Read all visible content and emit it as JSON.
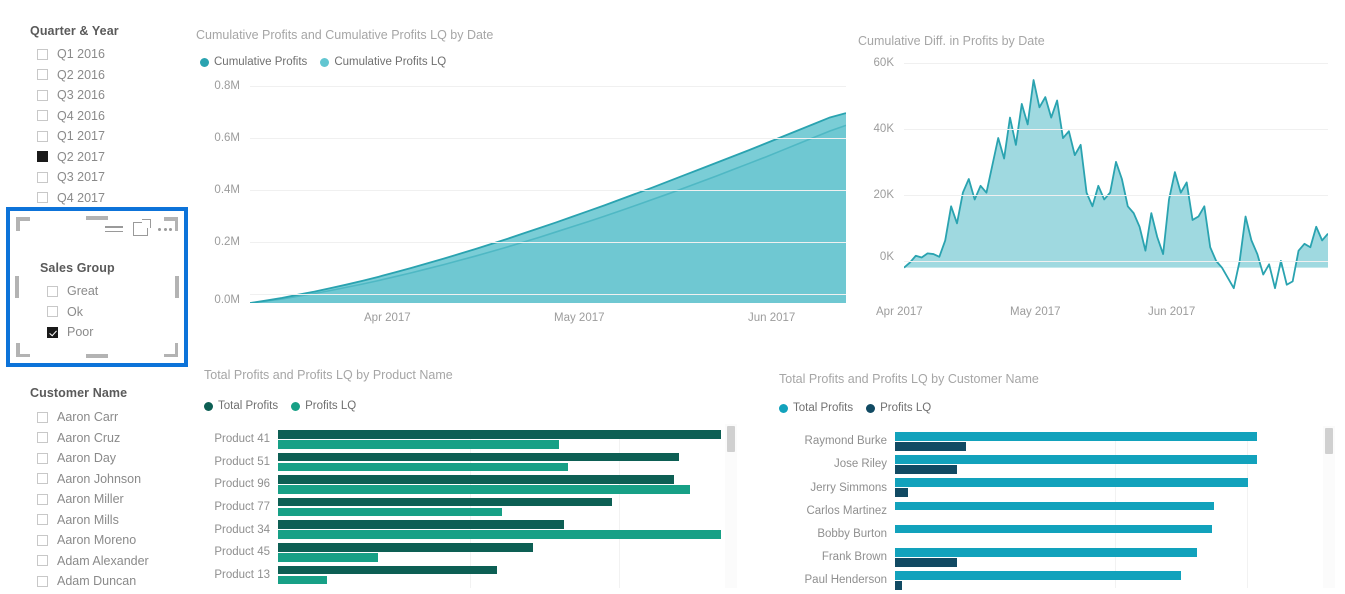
{
  "slicers": {
    "quarter": {
      "title": "Quarter & Year",
      "items": [
        {
          "label": "Q1 2016",
          "checked": false
        },
        {
          "label": "Q2 2016",
          "checked": false
        },
        {
          "label": "Q3 2016",
          "checked": false
        },
        {
          "label": "Q4 2016",
          "checked": false
        },
        {
          "label": "Q1 2017",
          "checked": false
        },
        {
          "label": "Q2 2017",
          "checked": true
        },
        {
          "label": "Q3 2017",
          "checked": false
        },
        {
          "label": "Q4 2017",
          "checked": false
        }
      ]
    },
    "sales_group": {
      "title": "Sales Group",
      "selected": true,
      "items": [
        {
          "label": "Great",
          "checked": false
        },
        {
          "label": "Ok",
          "checked": false
        },
        {
          "label": "Poor",
          "checked": true
        }
      ],
      "toolbar": {
        "filter": "filter-icon",
        "focus": "focus-mode-icon",
        "more": "more-options-icon"
      }
    },
    "customer": {
      "title": "Customer Name",
      "items": [
        {
          "label": "Aaron Carr",
          "checked": false
        },
        {
          "label": "Aaron Cruz",
          "checked": false
        },
        {
          "label": "Aaron Day",
          "checked": false
        },
        {
          "label": "Aaron Johnson",
          "checked": false
        },
        {
          "label": "Aaron Miller",
          "checked": false
        },
        {
          "label": "Aaron Mills",
          "checked": false
        },
        {
          "label": "Aaron Moreno",
          "checked": false
        },
        {
          "label": "Adam Alexander",
          "checked": false
        },
        {
          "label": "Adam Duncan",
          "checked": false
        }
      ]
    }
  },
  "colors": {
    "teal_dark": "#2AA3B0",
    "teal_light": "#7ACDD6",
    "green_dark": "#0D5F54",
    "green_mid": "#17A086",
    "cyan": "#12A2BC",
    "navy": "#114A63",
    "selection_blue": "#0D73D9"
  },
  "chart_data": [
    {
      "id": "cumulative_profits",
      "type": "area",
      "title": "Cumulative Profits and Cumulative Profits LQ by Date",
      "xlabel": "",
      "ylabel": "",
      "ylim": [
        0,
        800000
      ],
      "yticks": [
        "0.0M",
        "0.2M",
        "0.4M",
        "0.6M",
        "0.8M"
      ],
      "ytick_values": [
        0,
        200000,
        400000,
        600000,
        800000
      ],
      "xticks": [
        "Apr 2017",
        "May 2017",
        "Jun 2017"
      ],
      "grid": true,
      "legend_position": "top-left",
      "series": [
        {
          "name": "Cumulative Profits",
          "color": "#2AA3B0",
          "values": [
            0,
            9000,
            19000,
            31000,
            42000,
            55000,
            68000,
            82000,
            97000,
            113000,
            129000,
            146000,
            163000,
            181000,
            199000,
            218000,
            237000,
            257000,
            277000,
            297000,
            318000,
            339000,
            360000,
            382000,
            404000,
            426000,
            449000,
            472000,
            495000,
            518000,
            541000,
            564000,
            588000,
            612000,
            636000,
            660000,
            684000,
            700000
          ]
        },
        {
          "name": "Cumulative Profits LQ",
          "color": "#7ACDD6",
          "values": [
            0,
            7000,
            15000,
            25000,
            35000,
            46000,
            58000,
            70000,
            83000,
            97000,
            111000,
            126000,
            141000,
            157000,
            173000,
            190000,
            207000,
            225000,
            243000,
            262000,
            281000,
            300000,
            320000,
            340000,
            361000,
            382000,
            403000,
            425000,
            447000,
            469000,
            492000,
            515000,
            538000,
            562000,
            586000,
            610000,
            634000,
            655000
          ]
        }
      ]
    },
    {
      "id": "cumulative_diff",
      "type": "area",
      "title": "Cumulative Diff. in Profits by Date",
      "xlabel": "",
      "ylabel": "",
      "ylim": [
        -8000,
        60000
      ],
      "yticks": [
        "0K",
        "20K",
        "40K",
        "60K"
      ],
      "ytick_values": [
        0,
        20000,
        40000,
        60000
      ],
      "xticks": [
        "Apr 2017",
        "May 2017",
        "Jun 2017"
      ],
      "grid": true,
      "legend_position": "none",
      "series": [
        {
          "name": "Cumulative Diff. in Profits",
          "color": "#2AA3B0",
          "values": [
            0,
            1500,
            3500,
            3000,
            4200,
            4000,
            3200,
            8000,
            18000,
            13000,
            22000,
            26000,
            20000,
            24000,
            22000,
            30000,
            38000,
            32000,
            44000,
            36000,
            48000,
            42000,
            55000,
            47000,
            50000,
            44000,
            49000,
            38000,
            40000,
            33000,
            36000,
            22000,
            18000,
            24000,
            20000,
            22000,
            31000,
            26000,
            18000,
            16000,
            12000,
            5000,
            16000,
            9000,
            4000,
            20000,
            28000,
            22000,
            25000,
            14000,
            15000,
            18000,
            6000,
            2000,
            0,
            -3000,
            -6000,
            2000,
            15000,
            8000,
            4000,
            -2000,
            1000,
            -6000,
            2000,
            -5000,
            -4000,
            5000,
            7000,
            6000,
            12000,
            8000,
            10000
          ]
        }
      ]
    },
    {
      "id": "profits_by_product",
      "type": "bar",
      "orientation": "horizontal",
      "title": "Total Profits and Profits LQ by Product Name",
      "categories": [
        "Product 41",
        "Product 51",
        "Product 96",
        "Product 77",
        "Product 34",
        "Product 45",
        "Product 13"
      ],
      "legend_position": "top-left",
      "grid": true,
      "series": [
        {
          "name": "Total Profits",
          "color": "#0D5F54",
          "values": [
            100,
            90.5,
            89.5,
            75.5,
            64.5,
            57.5,
            49.5
          ]
        },
        {
          "name": "Profits LQ",
          "color": "#17A086",
          "values": [
            63.5,
            65.5,
            93,
            50.5,
            100,
            22.5,
            11
          ]
        }
      ]
    },
    {
      "id": "profits_by_customer",
      "type": "bar",
      "orientation": "horizontal",
      "title": "Total Profits and Profits LQ by Customer Name",
      "categories": [
        "Raymond Burke",
        "Jose Riley",
        "Jerry Simmons",
        "Carlos Martinez",
        "Bobby Burton",
        "Frank Brown",
        "Paul Henderson"
      ],
      "legend_position": "top-left",
      "grid": true,
      "series": [
        {
          "name": "Total Profits",
          "color": "#12A2BC",
          "values": [
            100,
            100,
            97.5,
            88,
            87.5,
            83.5,
            79
          ]
        },
        {
          "name": "Profits LQ",
          "color": "#114A63",
          "values": [
            19.5,
            17,
            3.5,
            0,
            0,
            17,
            2
          ]
        }
      ]
    }
  ]
}
